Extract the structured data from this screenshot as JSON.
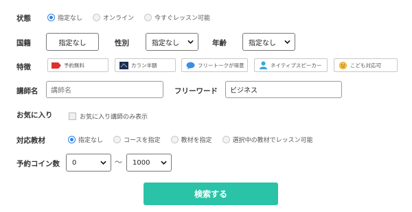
{
  "status": {
    "label": "状態",
    "options": [
      "指定なし",
      "オンライン",
      "今すぐレッスン可能"
    ],
    "selected": "指定なし"
  },
  "country": {
    "label": "国籍",
    "value": "指定なし"
  },
  "gender": {
    "label": "性別",
    "value": "指定なし"
  },
  "age": {
    "label": "年齢",
    "value": "指定なし"
  },
  "features": {
    "label": "特徴",
    "chips": [
      {
        "label": "予約無料",
        "icon": "tag-icon"
      },
      {
        "label": "カラン半額",
        "icon": "book-icon"
      },
      {
        "label": "フリートークが得意",
        "icon": "chat-bubble-icon"
      },
      {
        "label": "ネイティブスピーカー",
        "icon": "person-icon"
      },
      {
        "label": "こども対応可",
        "icon": "smiley-icon"
      }
    ]
  },
  "teacher_name": {
    "label": "講師名",
    "placeholder": "講師名"
  },
  "free_word": {
    "label": "フリーワード",
    "value": "ビジネス"
  },
  "favorites": {
    "label": "お気に入り",
    "checkbox_label": "お気に入り講師のみ表示"
  },
  "material": {
    "label": "対応教材",
    "options": [
      "指定なし",
      "コースを指定",
      "教材を指定",
      "選択中の教材でレッスン可能"
    ],
    "selected": "指定なし"
  },
  "coins": {
    "label": "予約コイン数",
    "min": "0",
    "separator": "〜",
    "max": "1000"
  },
  "submit_label": "検索する",
  "colors": {
    "accent": "#2bc3a8",
    "radio": "#2a82e4"
  }
}
